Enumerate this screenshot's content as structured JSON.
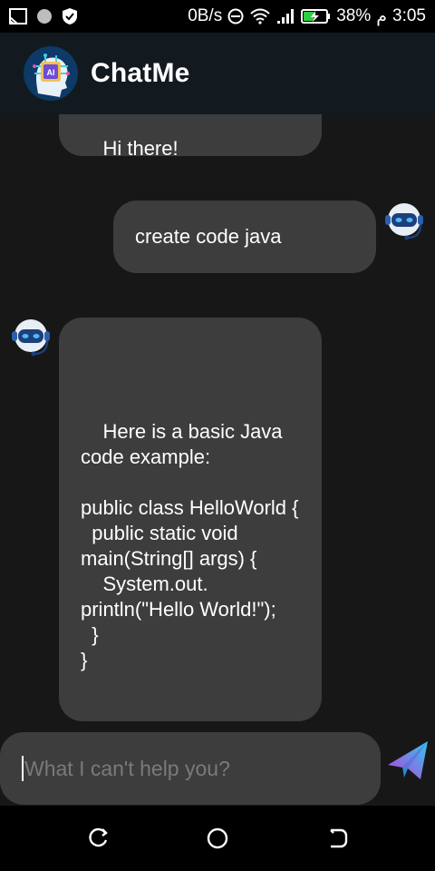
{
  "status_bar": {
    "speed": "0B/s",
    "battery": "38%",
    "am_pm": "م",
    "time": "3:05",
    "icons": [
      "screen-cast-icon",
      "circle-notification-icon",
      "shield-icon",
      "dnd-icon",
      "wifi-icon",
      "signal-icon",
      "battery-charging-icon"
    ]
  },
  "app": {
    "title": "ChatMe",
    "logo_icon": "ai-brain-logo-icon"
  },
  "messages": [
    {
      "role": "bot",
      "text": "Hi there!"
    },
    {
      "role": "user",
      "text": "create code java",
      "avatar_icon": "robot-avatar-icon"
    },
    {
      "role": "bot",
      "text": "Here is a basic Java code example:\n\npublic class HelloWorld {\n  public static void main(String[] args) {\n    System.out.\nprintln(\"Hello World!\");\n  }\n}",
      "avatar_icon": "robot-avatar-icon"
    }
  ],
  "composer": {
    "placeholder": "What I can't help you?",
    "send_icon": "paper-plane-send-icon"
  },
  "nav_bar": {
    "icons": [
      "recent-apps-icon",
      "home-icon",
      "back-icon"
    ]
  },
  "colors": {
    "background": "#171717",
    "app_bar": "#121a20",
    "bubble": "#3d3d3d",
    "send_gradient_start": "#c13ad8",
    "send_gradient_end": "#2ec7f0"
  }
}
